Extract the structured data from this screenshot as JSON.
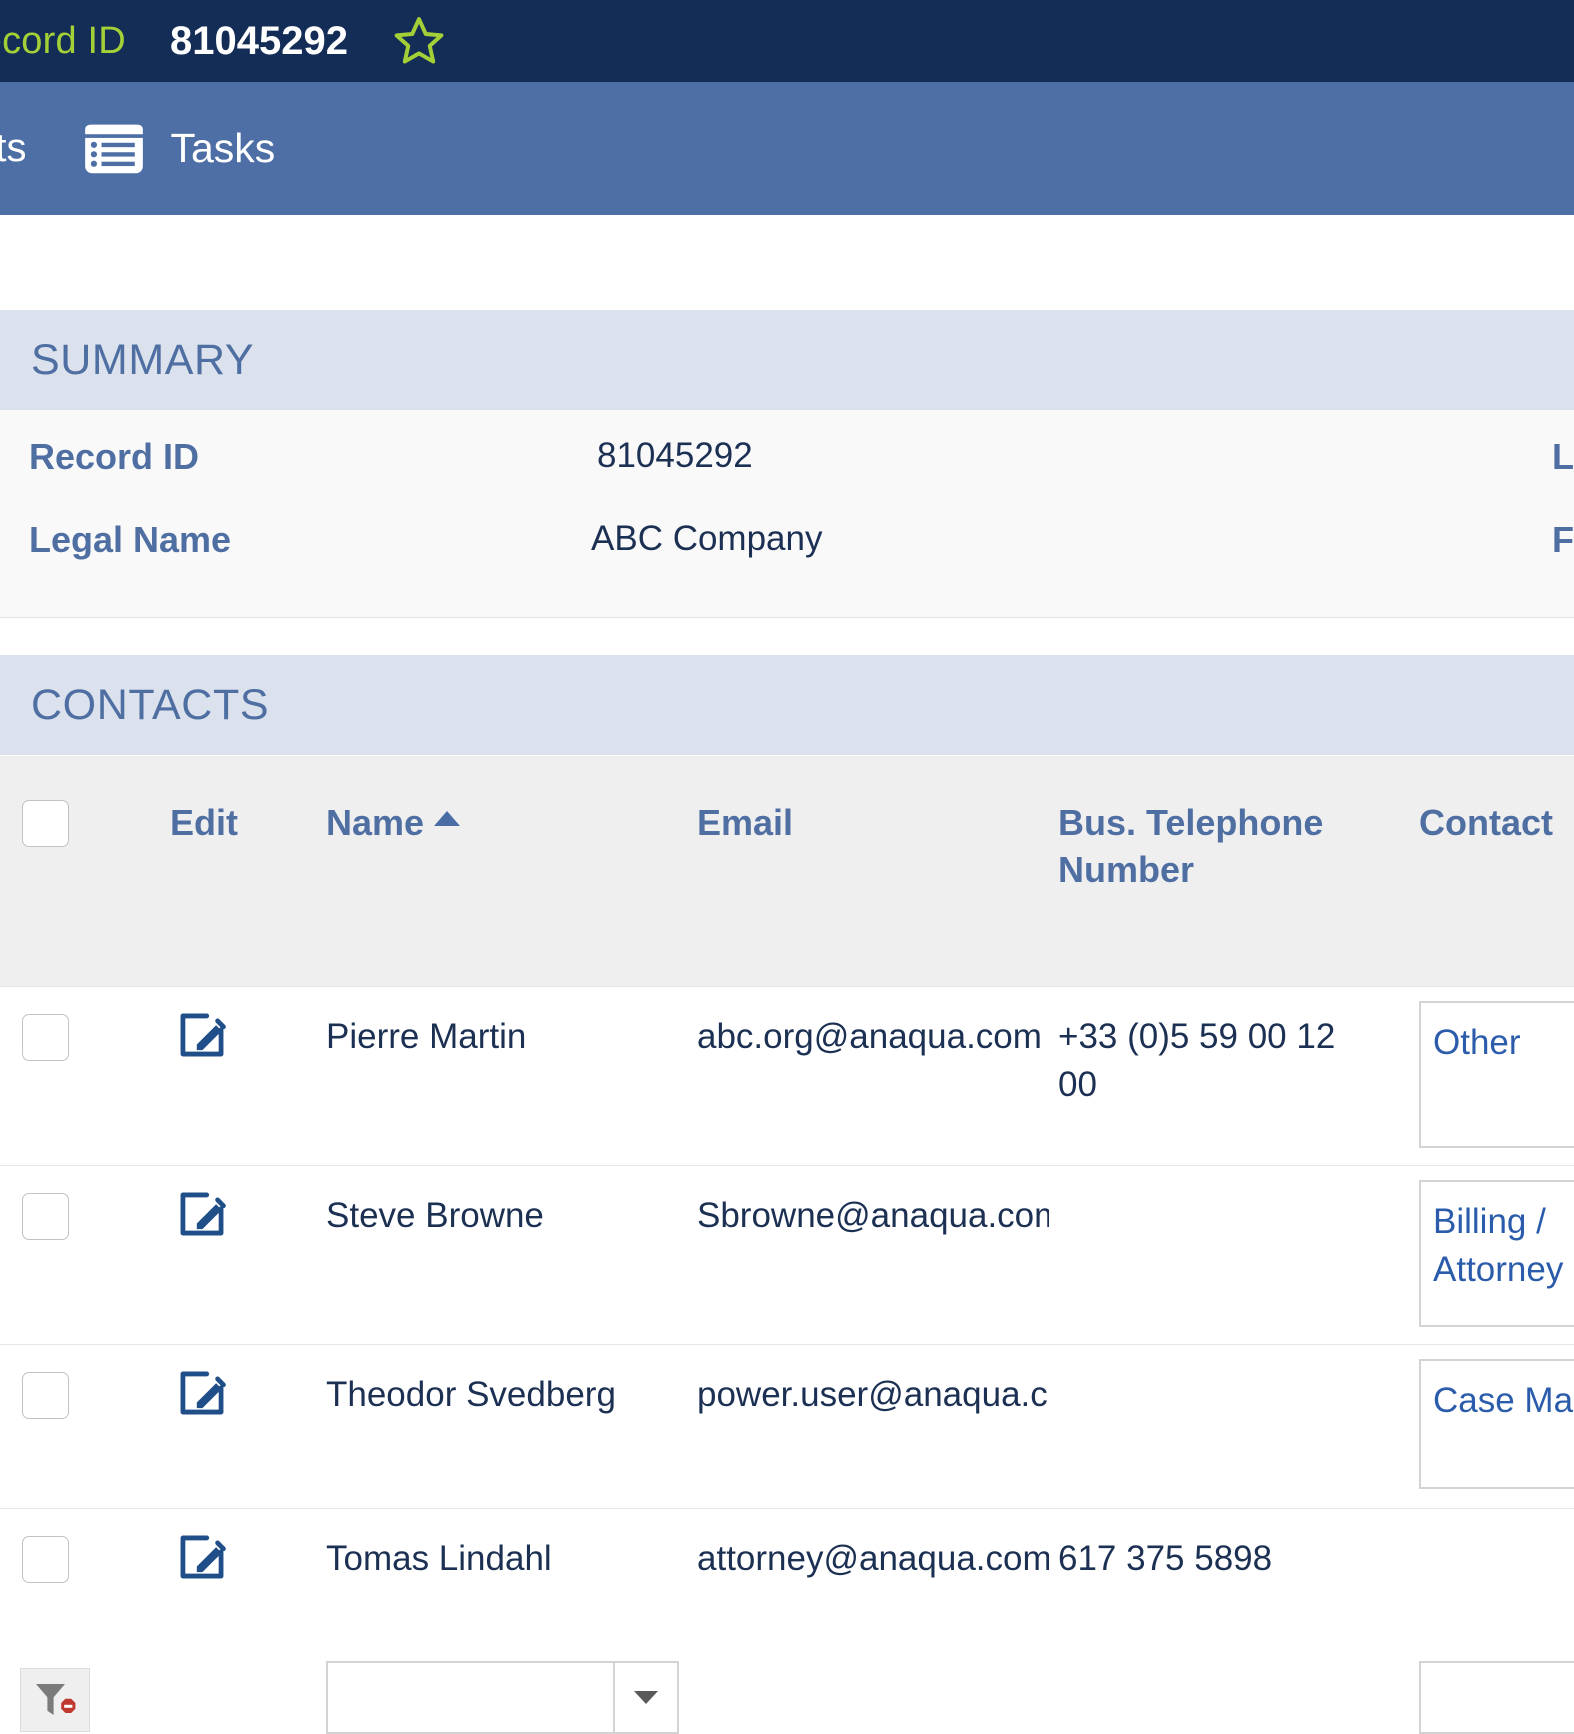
{
  "titlebar": {
    "label": "...tion Record ID",
    "value": "81045292",
    "star_icon": "star-outline-icon",
    "bg": "#132d56",
    "label_color": "#a4d037"
  },
  "navbar": {
    "clipped_item": "...ts",
    "tasks": {
      "label": "Tasks",
      "icon": "list-view-icon"
    },
    "bg": "#4d6fa5"
  },
  "summary": {
    "section_title": "SUMMARY",
    "rows": [
      {
        "label": "Record ID",
        "value": "81045292",
        "right_label": "Last"
      },
      {
        "label": "Legal Name",
        "value": "ABC Company",
        "right_label": "Firm"
      }
    ]
  },
  "contacts": {
    "section_title": "CONTACTS",
    "columns": [
      {
        "key": "select",
        "label": ""
      },
      {
        "key": "edit",
        "label": "Edit"
      },
      {
        "key": "name",
        "label": "Name",
        "sorted": "asc"
      },
      {
        "key": "email",
        "label": "Email"
      },
      {
        "key": "phone",
        "label": "Bus. Telephone Number"
      },
      {
        "key": "type",
        "label": "Contact"
      }
    ],
    "filter_row": {
      "clear_filter_icon": "filter-remove-icon",
      "name_filter_value": "",
      "name_filter_placeholder": "",
      "type_filter_value": "",
      "type_filter_placeholder": ""
    },
    "rows": [
      {
        "name": "Pierre Martin",
        "email": "abc.org@anaqua.com",
        "phone": "+33 (0)5 59 00 12 00",
        "type": "Other",
        "edit_icon": "edit-pencil-icon"
      },
      {
        "name": "Steve Browne",
        "email": "Sbrowne@anaqua.com",
        "phone": "",
        "type": "Billing / Attorney",
        "edit_icon": "edit-pencil-icon"
      },
      {
        "name": "Theodor Svedberg",
        "email": "power.user@anaqua.com",
        "phone": "",
        "type": "Case Manager",
        "edit_icon": "edit-pencil-icon"
      },
      {
        "name": "Tomas Lindahl",
        "email": "attorney@anaqua.com",
        "phone": "617 375 5898",
        "type": "",
        "edit_icon": "edit-pencil-icon"
      }
    ]
  },
  "colors": {
    "navy": "#132d56",
    "blue": "#4d6fa5",
    "green": "#a4d037",
    "band": "#dce2ed",
    "header_text": "#4f6fa3",
    "value_text": "#1b3052",
    "link": "#2b5cab"
  }
}
